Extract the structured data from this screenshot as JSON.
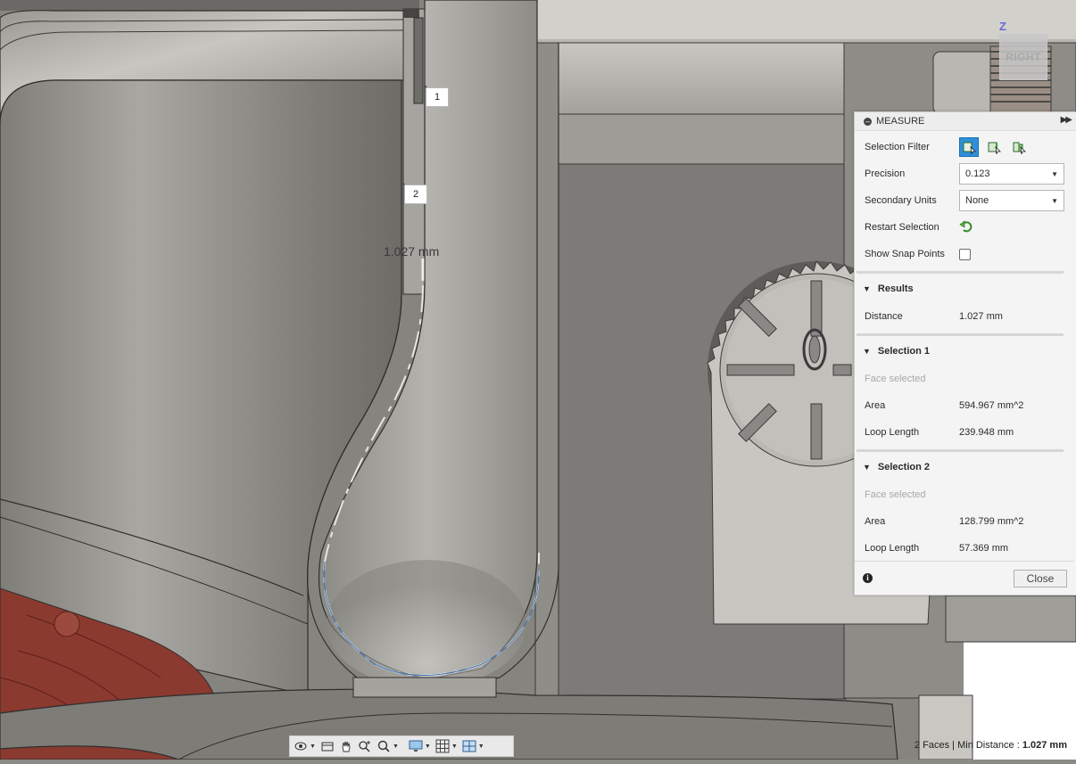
{
  "viewport": {
    "callouts": [
      "1",
      "2"
    ],
    "dimension_label": "1.027 mm",
    "viewcube": {
      "axis": "Z",
      "face": "RIGHT"
    }
  },
  "measure": {
    "title": "MEASURE",
    "selection_filter_label": "Selection Filter",
    "precision_label": "Precision",
    "precision_value": "0.123",
    "secondary_units_label": "Secondary Units",
    "secondary_units_value": "None",
    "restart_selection_label": "Restart Selection",
    "show_snap_points_label": "Show Snap Points",
    "show_snap_points_checked": false,
    "results": {
      "heading": "Results",
      "distance_label": "Distance",
      "distance_value": "1.027 mm"
    },
    "selection1": {
      "heading": "Selection 1",
      "status": "Face selected",
      "area_label": "Area",
      "area_value": "594.967 mm^2",
      "loop_label": "Loop Length",
      "loop_value": "239.948 mm"
    },
    "selection2": {
      "heading": "Selection 2",
      "status": "Face selected",
      "area_label": "Area",
      "area_value": "128.799 mm^2",
      "loop_label": "Loop Length",
      "loop_value": "57.369 mm"
    },
    "close_label": "Close"
  },
  "status_bar": {
    "prefix": "2 Faces | Min Distance : ",
    "value": "1.027 mm"
  },
  "colors": {
    "accent": "#2f8fd9",
    "red_part": "#8b3a30"
  }
}
